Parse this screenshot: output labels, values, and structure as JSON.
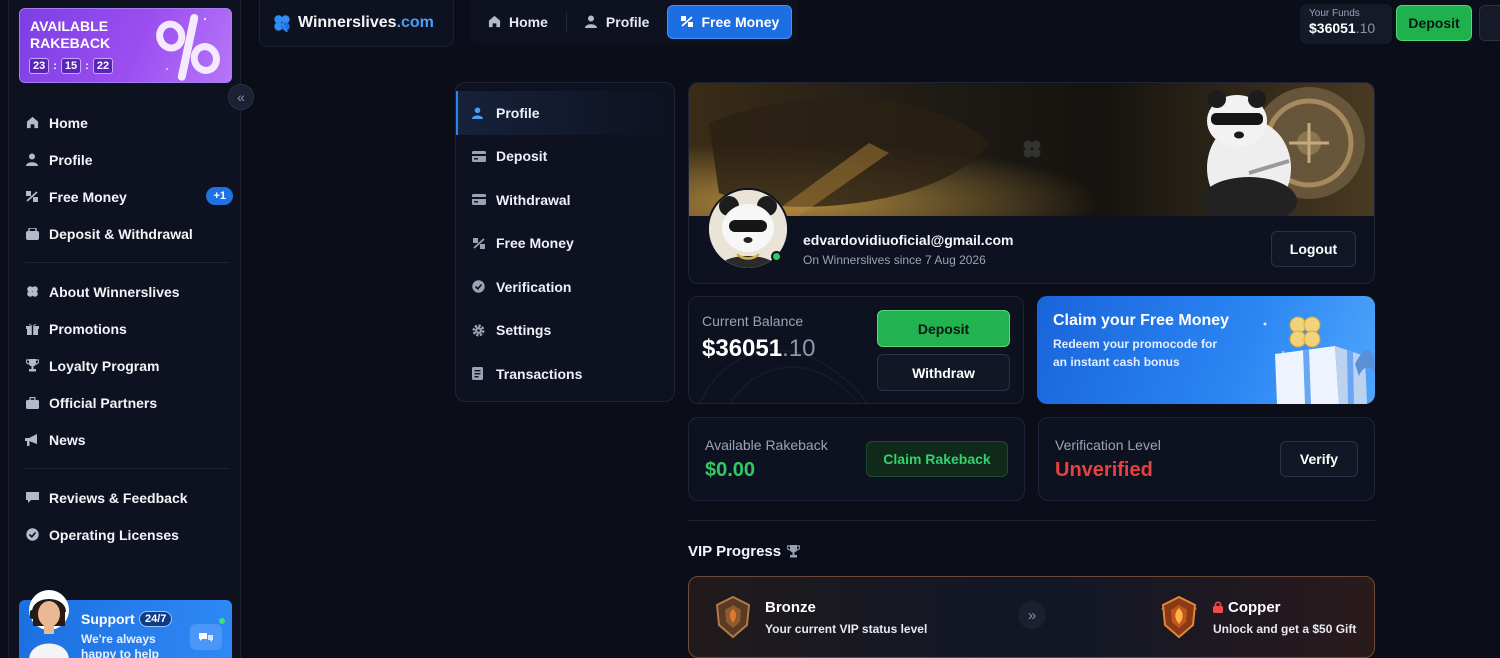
{
  "promo": {
    "title": "AVAILABLE RAKEBACK",
    "timer": [
      "23",
      "15",
      "22"
    ],
    "separator": ":"
  },
  "sidebar": {
    "collapse_glyph": "«",
    "items": [
      {
        "label": "Home",
        "icon": "home-icon"
      },
      {
        "label": "Profile",
        "icon": "user-icon"
      },
      {
        "label": "Free Money",
        "icon": "free-money-icon",
        "badge": "+1"
      },
      {
        "label": "Deposit & Withdrawal",
        "icon": "wallet-icon"
      },
      {
        "label": "About Winnerslives",
        "icon": "clover-icon"
      },
      {
        "label": "Promotions",
        "icon": "gift-icon"
      },
      {
        "label": "Loyalty Program",
        "icon": "trophy-icon"
      },
      {
        "label": "Official Partners",
        "icon": "briefcase-icon"
      },
      {
        "label": "News",
        "icon": "megaphone-icon"
      },
      {
        "label": "Reviews & Feedback",
        "icon": "chat-icon"
      },
      {
        "label": "Operating Licenses",
        "icon": "badge-check-icon"
      }
    ]
  },
  "support": {
    "title": "Support",
    "tag": "24/7",
    "subtitle": "We're always happy to help"
  },
  "brand": {
    "name": "Winnerslives",
    "domain": ".com",
    "accent": "#4d9df7"
  },
  "topnav": {
    "items": [
      {
        "label": "Home",
        "icon": "home-icon"
      },
      {
        "label": "Profile",
        "icon": "user-icon"
      },
      {
        "label": "Free Money",
        "icon": "free-money-icon",
        "active": true
      }
    ]
  },
  "funds": {
    "label": "Your Funds",
    "whole": "$36051",
    "decimal": ".10",
    "deposit_label": "Deposit"
  },
  "profile_menu": {
    "items": [
      {
        "label": "Profile",
        "icon": "user-icon",
        "active": true
      },
      {
        "label": "Deposit",
        "icon": "card-icon"
      },
      {
        "label": "Withdrawal",
        "icon": "card-icon"
      },
      {
        "label": "Free Money",
        "icon": "free-money-icon"
      },
      {
        "label": "Verification",
        "icon": "badge-check-icon"
      },
      {
        "label": "Settings",
        "icon": "gear-icon"
      },
      {
        "label": "Transactions",
        "icon": "receipt-icon"
      }
    ]
  },
  "profile": {
    "email": "edvardovidiuoficial@gmail.com",
    "since": "On Winnerslives since 7 Aug 2026",
    "logout_label": "Logout"
  },
  "balance": {
    "label": "Current Balance",
    "whole": "$36051",
    "decimal": ".10",
    "deposit_label": "Deposit",
    "withdraw_label": "Withdraw"
  },
  "claim": {
    "title": "Claim your Free Money",
    "subtitle": "Redeem your promocode for an instant cash bonus"
  },
  "rakeback": {
    "label": "Available Rakeback",
    "value": "$0.00",
    "button": "Claim Rakeback"
  },
  "verification": {
    "label": "Verification Level",
    "value": "Unverified",
    "button": "Verify"
  },
  "vip": {
    "title": "VIP Progress",
    "current": {
      "name": "Bronze",
      "subtitle": "Your current VIP status level"
    },
    "next": {
      "name": "Copper",
      "subtitle": "Unlock and get a $50 Gift"
    },
    "arrow_glyph": "»"
  },
  "colors": {
    "background": "#0b0e18",
    "primary": "#1d6de3",
    "success": "#22b24f",
    "danger": "#e5413e",
    "promo_purple": "#9b4ef0"
  }
}
